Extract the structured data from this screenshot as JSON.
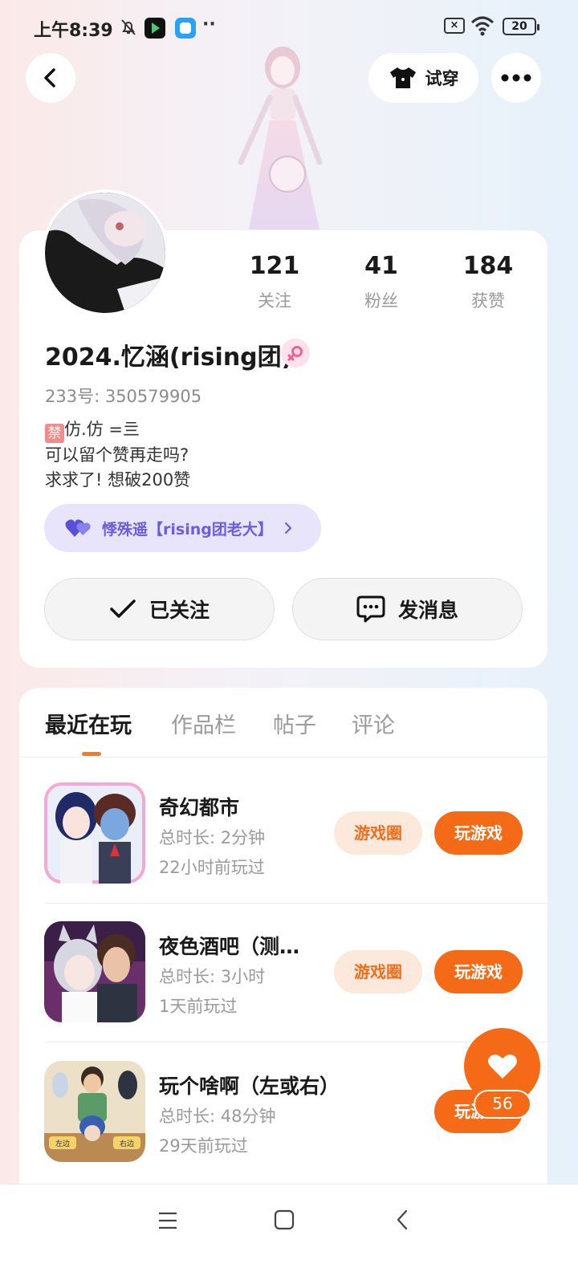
{
  "status_bar": {
    "time": "上午8:39",
    "battery": "20",
    "icons": [
      "bell-muted-icon",
      "app-icon",
      "app-icon",
      "more-dots-icon",
      "sim-off-icon",
      "wifi-icon",
      "battery-icon"
    ]
  },
  "top_actions": {
    "back_icon": "chevron-left-icon",
    "try_on_label": "试穿",
    "try_on_icon": "tshirt-icon",
    "more_icon": "more-horizontal-icon"
  },
  "profile": {
    "stats": [
      {
        "value": "121",
        "label": "关注"
      },
      {
        "value": "41",
        "label": "粉丝"
      },
      {
        "value": "184",
        "label": "获赞"
      }
    ],
    "name": "2024.忆涵(rising团)",
    "gender_icon": "female-icon",
    "uid": "233号: 350579905",
    "bio_tag": "禁",
    "bio_lines": [
      "仿.仿 =亖",
      "可以留个赞再走吗?",
      "求求了! 想破200赞"
    ],
    "relation": {
      "label": "悸殊遥【rising团老大】",
      "icon": "double-heart-icon"
    },
    "follow_label": "已关注",
    "message_label": "发消息"
  },
  "tabs": [
    "最近在玩",
    "作品栏",
    "帖子",
    "评论"
  ],
  "active_tab": 0,
  "games": [
    {
      "name": "奇幻都市",
      "duration": "总时长: 2分钟",
      "last_played": "22小时前玩过",
      "circle_label": "游戏圈",
      "play_label": "玩游戏"
    },
    {
      "name": "夜色酒吧（测…",
      "duration": "总时长: 3小时",
      "last_played": "1天前玩过",
      "circle_label": "游戏圈",
      "play_label": "玩游戏"
    },
    {
      "name": "玩个啥啊（左或右）",
      "duration": "总时长: 48分钟",
      "last_played": "29天前玩过",
      "play_label": "玩游戏",
      "icon_labels": [
        "左边",
        "右边"
      ]
    }
  ],
  "like_fab": {
    "count": "56",
    "icon": "heart-icon"
  },
  "nav_bar": {
    "icons": [
      "menu-icon",
      "home-square-icon",
      "back-icon"
    ]
  },
  "colors": {
    "accent": "#f56a16",
    "accent_light": "#fde8dc",
    "relation_bg": "#e7e4fb",
    "relation_text": "#6b5ee0"
  }
}
